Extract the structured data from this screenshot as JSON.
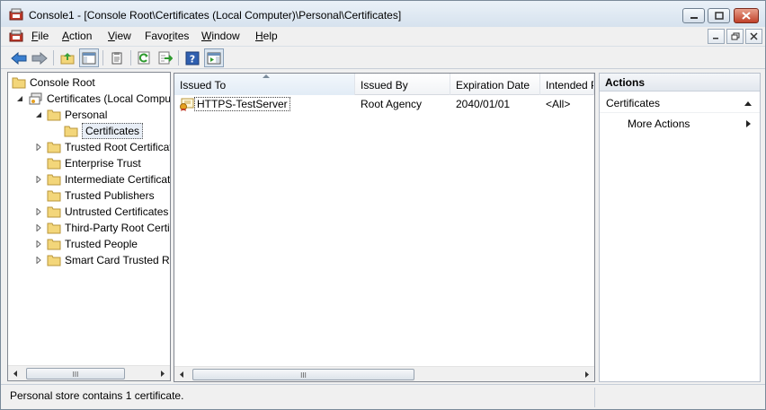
{
  "window": {
    "title": "Console1 - [Console Root\\Certificates (Local Computer)\\Personal\\Certificates]"
  },
  "menu": {
    "items": [
      {
        "pre": "",
        "ul": "F",
        "post": "ile"
      },
      {
        "pre": "",
        "ul": "A",
        "post": "ction"
      },
      {
        "pre": "",
        "ul": "V",
        "post": "iew"
      },
      {
        "pre": "Favo",
        "ul": "r",
        "post": "ites"
      },
      {
        "pre": "",
        "ul": "W",
        "post": "indow"
      },
      {
        "pre": "",
        "ul": "H",
        "post": "elp"
      }
    ]
  },
  "tree": {
    "items": [
      {
        "label": "Console Root"
      },
      {
        "label": "Certificates (Local Computer)"
      },
      {
        "label": "Personal"
      },
      {
        "label": "Certificates"
      },
      {
        "label": "Trusted Root Certification Authorities"
      },
      {
        "label": "Enterprise Trust"
      },
      {
        "label": "Intermediate Certification Authorities"
      },
      {
        "label": "Trusted Publishers"
      },
      {
        "label": "Untrusted Certificates"
      },
      {
        "label": "Third-Party Root Certification Authorities"
      },
      {
        "label": "Trusted People"
      },
      {
        "label": "Smart Card Trusted Roots"
      }
    ]
  },
  "list": {
    "columns": [
      "Issued To",
      "Issued By",
      "Expiration Date",
      "Intended Purposes"
    ],
    "rows": [
      {
        "issued_to": "HTTPS-TestServer",
        "issued_by": "Root Agency",
        "expiration": "2040/01/01",
        "purposes": "<All>"
      }
    ]
  },
  "actions": {
    "header": "Actions",
    "section": "Certificates",
    "more": "More Actions"
  },
  "status": {
    "text": "Personal store contains 1 certificate."
  },
  "colors": {
    "selection_fill": "#e8eef6",
    "folder_fill": "#f3d67a",
    "close_button": "#c0412a"
  }
}
